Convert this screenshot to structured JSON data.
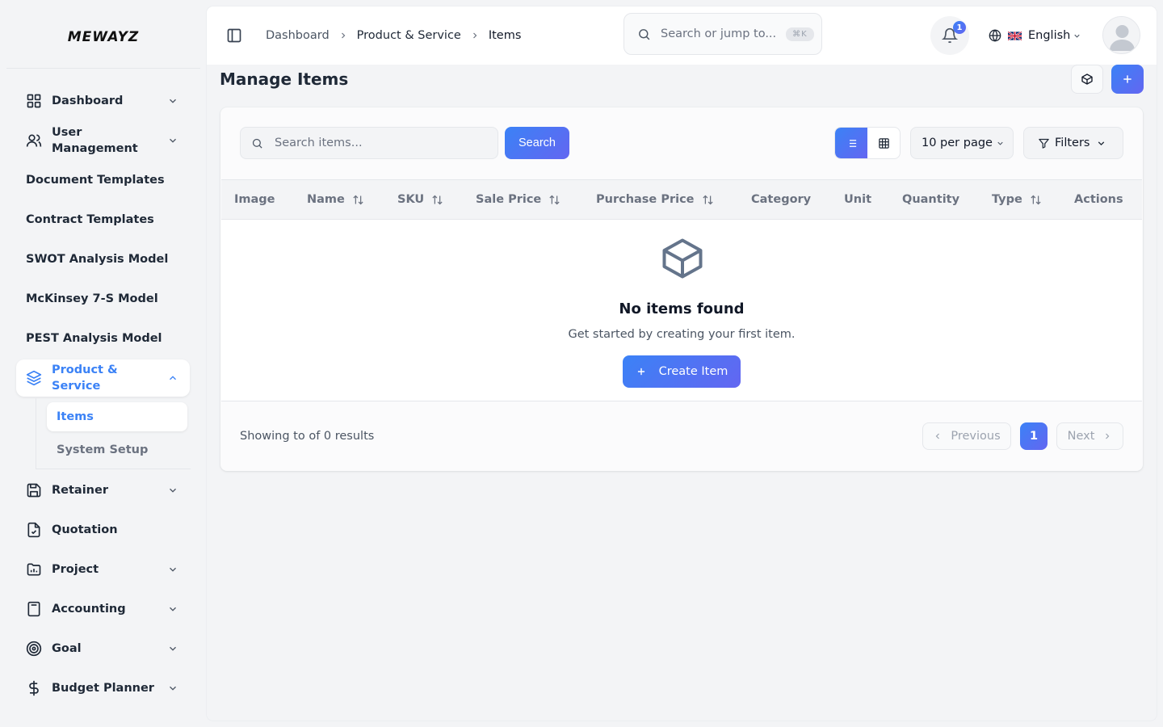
{
  "app": {
    "logo": "MEWAYZ"
  },
  "sidebar": {
    "items": [
      {
        "label": "Dashboard"
      },
      {
        "label": "User Management"
      },
      {
        "label": "Document Templates"
      },
      {
        "label": "Contract Templates"
      },
      {
        "label": "SWOT Analysis Model"
      },
      {
        "label": "McKinsey 7-S Model"
      },
      {
        "label": "PEST Analysis Model"
      },
      {
        "label": "Product & Service"
      },
      {
        "label": "Retainer"
      },
      {
        "label": "Quotation"
      },
      {
        "label": "Project"
      },
      {
        "label": "Accounting"
      },
      {
        "label": "Goal"
      },
      {
        "label": "Budget Planner"
      }
    ],
    "submenu": [
      {
        "label": "Items"
      },
      {
        "label": "System Setup"
      }
    ]
  },
  "topbar": {
    "breadcrumb": [
      "Dashboard",
      "Product & Service",
      "Items"
    ],
    "search_placeholder": "Search or jump to...",
    "search_shortcut": "⌘K",
    "notification_count": "1",
    "language": "English"
  },
  "page": {
    "title": "Manage Items"
  },
  "toolbar": {
    "search_placeholder": "Search items...",
    "search_button": "Search",
    "per_page": "10 per page",
    "filters_label": "Filters"
  },
  "table": {
    "columns": [
      "Image",
      "Name",
      "SKU",
      "Sale Price",
      "Purchase Price",
      "Category",
      "Unit",
      "Quantity",
      "Type",
      "Actions"
    ],
    "rows": []
  },
  "empty": {
    "title": "No items found",
    "subtitle": "Get started by creating your first item.",
    "button": "Create Item"
  },
  "pagination": {
    "summary": "Showing to of 0 results",
    "previous": "Previous",
    "current_page": "1",
    "next": "Next"
  },
  "colors": {
    "accent_start": "#3b82f6",
    "accent_end": "#6366f1",
    "active_text": "#3b82f6"
  }
}
